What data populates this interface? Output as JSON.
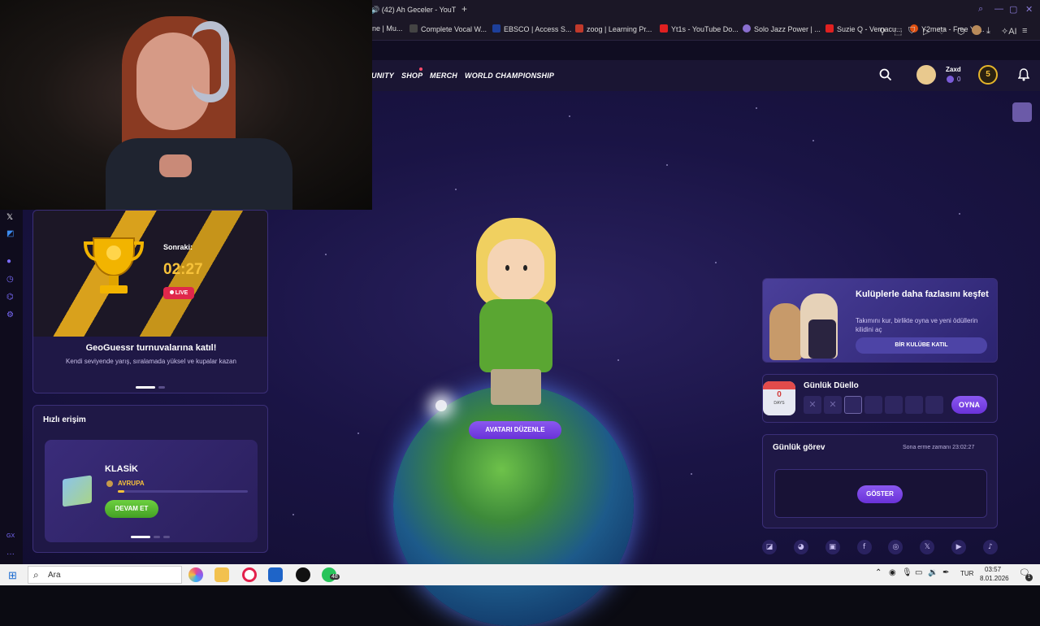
{
  "browser": {
    "tab_title": "(42) Ah Geceler - YouT",
    "bookmarks": [
      "ne | Mu...",
      "Complete Vocal W...",
      "EBSCO | Access S...",
      "zoog | Learning Pr...",
      "Yt1s - YouTube Do...",
      "Solo Jazz Power | ...",
      "Suzie Q - Vernacu...",
      "Y2meta - Free Yo..."
    ],
    "ai_label": "AI"
  },
  "nav": {
    "items": [
      "UNITY",
      "SHOP",
      "MERCH",
      "WORLD CHAMPIONSHIP"
    ],
    "username": "Zaxd",
    "coins": "0",
    "level": "5"
  },
  "tournament": {
    "next_label": "Sonraki:",
    "timer": "02:27",
    "live_label": "LIVE",
    "title": "GeoGuessr turnuvalarına katıl!",
    "subtitle": "Kendi seviyende yarış, sıralamada yüksel ve kupalar kazan"
  },
  "quick_access": {
    "title": "Hızlı erişim",
    "mode": "KLASİK",
    "map": "AVRUPA",
    "progress": 0.05,
    "continue_label": "DEVAM ET"
  },
  "avatar": {
    "edit_label": "AVATARI DÜZENLE"
  },
  "clubs": {
    "title": "Kulüplerle daha fazlasını keşfet",
    "text": "Takımını kur, birlikte oyna ve yeni ödüllerin kilidini aç",
    "button": "BİR KULÜBE KATIL"
  },
  "duel": {
    "title": "Günlük Düello",
    "streak": "0",
    "streak_unit": "DAYS",
    "play_label": "OYNA",
    "slots": [
      "x",
      "x",
      "",
      "",
      "",
      "",
      ""
    ]
  },
  "daily_task": {
    "title": "Günlük görev",
    "deadline": "Sona erme zamanı 23:02:27",
    "show_label": "GÖSTER"
  },
  "socials": [
    "twitch",
    "reddit",
    "discord",
    "facebook",
    "instagram",
    "x",
    "youtube",
    "tiktok"
  ],
  "taskbar": {
    "search_placeholder": "Ara",
    "whatsapp_badge": "48",
    "lang": "TUR",
    "time": "03:57",
    "date": "8.01.2026",
    "notif": "1"
  },
  "colors": {
    "accent": "#7c4dff",
    "live": "#e0284b",
    "timer": "#f7c23a",
    "continue": "#4fae2c"
  }
}
